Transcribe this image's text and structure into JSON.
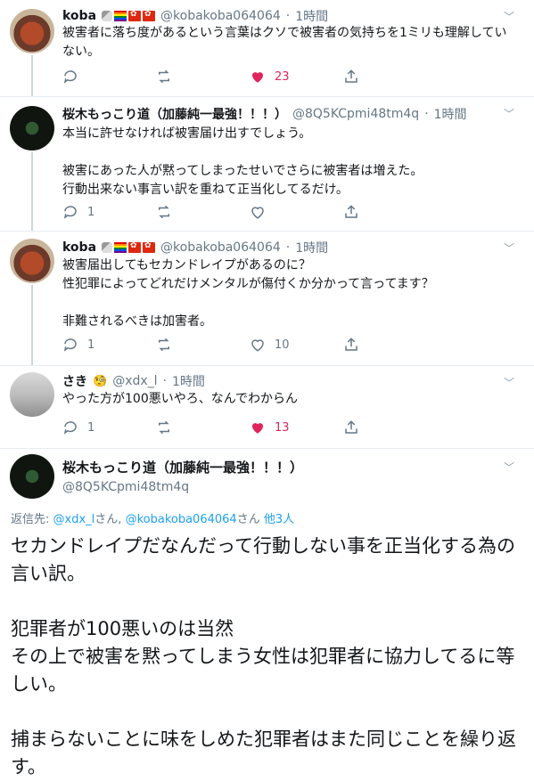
{
  "tweets": [
    {
      "name": "koba",
      "handle": "@kobakoba064064",
      "time": "1時間",
      "text": [
        "被害者に落ち度があるという言葉はクソで被害者の気持ちを1ミリも理解していない。"
      ],
      "reply_count": "",
      "like_count": "23",
      "liked": true
    },
    {
      "name": "桜木もっこり道（加藤純一最強！！！）",
      "handle": "@8Q5KCpmi48tm4q",
      "time": "1時間",
      "text": [
        "本当に許せなければ被害届け出すでしょう。",
        "",
        "被害にあった人が黙ってしまったせいでさらに被害者は増えた。",
        "行動出来ない事言い訳を重ねて正当化してるだけ。"
      ],
      "reply_count": "1",
      "like_count": "",
      "liked": false
    },
    {
      "name": "koba",
      "handle": "@kobakoba064064",
      "time": "1時間",
      "text": [
        "被害届出してもセカンドレイプがあるのに？",
        "性犯罪によってどれだけメンタルが傷付くか分かって言ってます？",
        "",
        "非難されるべきは加害者。"
      ],
      "reply_count": "1",
      "like_count": "10",
      "liked": false
    },
    {
      "name": "さき",
      "handle": "@xdx_l",
      "time": "1時間",
      "text": [
        "やった方が100悪いやろ、なんでわからん"
      ],
      "reply_count": "1",
      "like_count": "13",
      "liked": true
    }
  ],
  "main": {
    "name": "桜木もっこり道（加藤純一最強！！！）",
    "handle": "@8Q5KCpmi48tm4q",
    "reply_label": "返信先:",
    "reply_user1": "@xdx_l",
    "reply_sep1": "さん,",
    "reply_user2": "@kobakoba064064",
    "reply_sep2": "さん",
    "reply_others": "他3人",
    "text": [
      "セカンドレイプだなんだって行動しない事を正当化する為の　言い訳。",
      "",
      "犯罪者が100悪いのは当然",
      "その上で被害を黙ってしまう女性は犯罪者に協力してるに等しい。",
      "",
      "捕まらないことに味をしめた犯罪者はまた同じことを繰り返す。"
    ]
  },
  "colors": {
    "like": "#e0245e",
    "link": "#1da1f2",
    "muted": "#657786",
    "line": "#ccd6dd"
  },
  "icons": [
    "reply-icon",
    "retweet-icon",
    "like-icon",
    "share-icon",
    "chevron-down-icon"
  ]
}
